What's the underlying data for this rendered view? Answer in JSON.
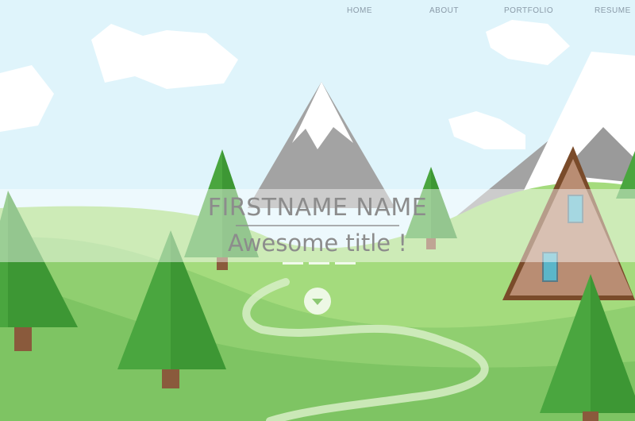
{
  "nav": {
    "items": [
      {
        "label": "HOME"
      },
      {
        "label": "ABOUT"
      },
      {
        "label": "PORTFOLIO"
      },
      {
        "label": "RESUME"
      }
    ]
  },
  "hero": {
    "name": "FIRSTNAME NAME",
    "title": "Awesome title !"
  },
  "colors": {
    "sky": "#dff4fb",
    "grass_light": "#a4db7d",
    "grass_mid": "#88c96a",
    "grass_dark": "#76bb5c",
    "tree": "#4aa63f",
    "trunk": "#8a5a3c",
    "mountain": "#a3a3a3",
    "snow": "#ffffff",
    "cabin_roof": "#7a4b2a",
    "cabin_wall": "#b98d73",
    "window": "#5bb6c9",
    "text": "#8c8c8c"
  },
  "icons": {
    "scroll": "chevron-down-icon"
  }
}
